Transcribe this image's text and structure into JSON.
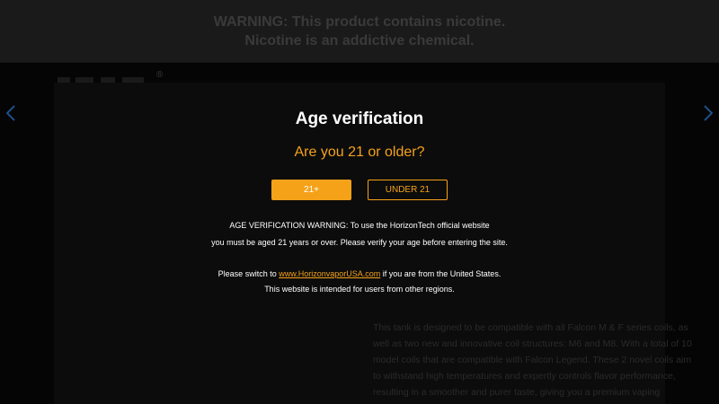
{
  "banner": {
    "line1": "WARNING: This product contains nicotine.",
    "line2": "Nicotine is an addictive chemical."
  },
  "brand": {
    "reg_mark": "®"
  },
  "product": {
    "description": "This tank is designed to be compatible with all Falcon M & F series coils, as well as two new and innovative coil structures: M6 and M8. With a total of 10 model coils that are compatible with Falcon Legend. These 2 novel coils aim to withstand high temperatures and expertly controls flavor performance, resulting in a smoother and purer taste, giving you a premium vaping experience."
  },
  "modal": {
    "title": "Age verification",
    "question": "Are you 21 or older?",
    "yes_label": "21+",
    "no_label": "UNDER 21",
    "warning_line1": "AGE VERIFICATION WARNING: To use the HorizonTech official website",
    "warning_line2": "you must be aged 21 years or over. Please verify your age before entering the site.",
    "switch_prefix": "Please switch to ",
    "switch_link": "www.HorizonvaporUSA.com",
    "switch_suffix": " if you are from the United States.",
    "regions_note": "This website is intended for users from other regions."
  },
  "icons": {
    "prev": "chevron-left-icon",
    "next": "chevron-right-icon"
  },
  "colors": {
    "accent": "#f5a219",
    "arrow": "#1e4f8a"
  }
}
